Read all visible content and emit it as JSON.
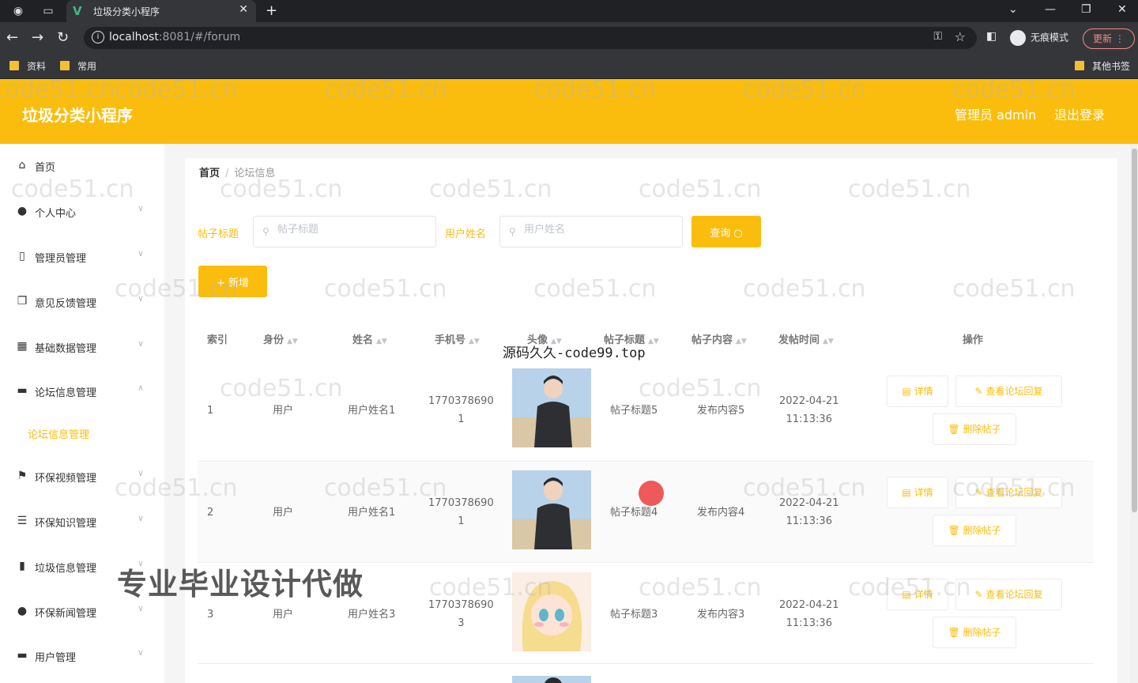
{
  "browser": {
    "tab_title": "垃圾分类小程序",
    "url_host": "localhost",
    "url_rest": ":8081/#/forum",
    "incognito_label": "无痕模式",
    "update_label": "更新",
    "bookmarks": [
      "资料",
      "常用"
    ],
    "other_bookmarks": "其他书签"
  },
  "header": {
    "title": "垃圾分类小程序",
    "user": "管理员 admin",
    "logout": "退出登录"
  },
  "sidebar": {
    "items": [
      {
        "label": "首页",
        "icon": "home-icon"
      },
      {
        "label": "个人中心",
        "icon": "user-icon"
      },
      {
        "label": "管理员管理",
        "icon": "phone-icon"
      },
      {
        "label": "意见反馈管理",
        "icon": "copy-icon"
      },
      {
        "label": "基础数据管理",
        "icon": "grid-icon"
      },
      {
        "label": "论坛信息管理",
        "icon": "monitor-icon"
      },
      {
        "label": "环保视频管理",
        "icon": "flag-icon"
      },
      {
        "label": "环保知识管理",
        "icon": "list-icon"
      },
      {
        "label": "垃圾信息管理",
        "icon": "bar-chart-icon"
      },
      {
        "label": "环保新闻管理",
        "icon": "bulb-icon"
      },
      {
        "label": "用户管理",
        "icon": "message-icon"
      }
    ],
    "active_sub": "论坛信息管理"
  },
  "breadcrumb": {
    "home": "首页",
    "current": "论坛信息"
  },
  "filters": {
    "title_label": "帖子标题",
    "title_placeholder": "帖子标题",
    "name_label": "用户姓名",
    "name_placeholder": "用户姓名",
    "query_button": "查询",
    "add_button": "+ 新增"
  },
  "table": {
    "headers": [
      "索引",
      "身份",
      "姓名",
      "手机号",
      "头像",
      "帖子标题",
      "帖子内容",
      "发帖时间",
      "操作"
    ],
    "rows": [
      {
        "index": "1",
        "role": "用户",
        "name": "用户姓名1",
        "phone1": "1770378690",
        "phone2": "1",
        "title": "帖子标题5",
        "content": "发布内容5",
        "date": "2022-04-21",
        "time": "11:13:36"
      },
      {
        "index": "2",
        "role": "用户",
        "name": "用户姓名1",
        "phone1": "1770378690",
        "phone2": "1",
        "title": "帖子标题4",
        "content": "发布内容4",
        "date": "2022-04-21",
        "time": "11:13:36"
      },
      {
        "index": "3",
        "role": "用户",
        "name": "用户姓名3",
        "phone1": "1770378690",
        "phone2": "3",
        "title": "帖子标题3",
        "content": "发布内容3",
        "date": "2022-04-21",
        "time": "11:13:36"
      }
    ],
    "op_detail": "详情",
    "op_view_replies": "查看论坛回复",
    "op_delete": "删除帖子"
  },
  "watermarks": {
    "site": "code51.cn",
    "code99": "源码久久-code99.top",
    "promo": "专业毕业设计代做"
  },
  "colors": {
    "accent": "#fbbd0d"
  }
}
